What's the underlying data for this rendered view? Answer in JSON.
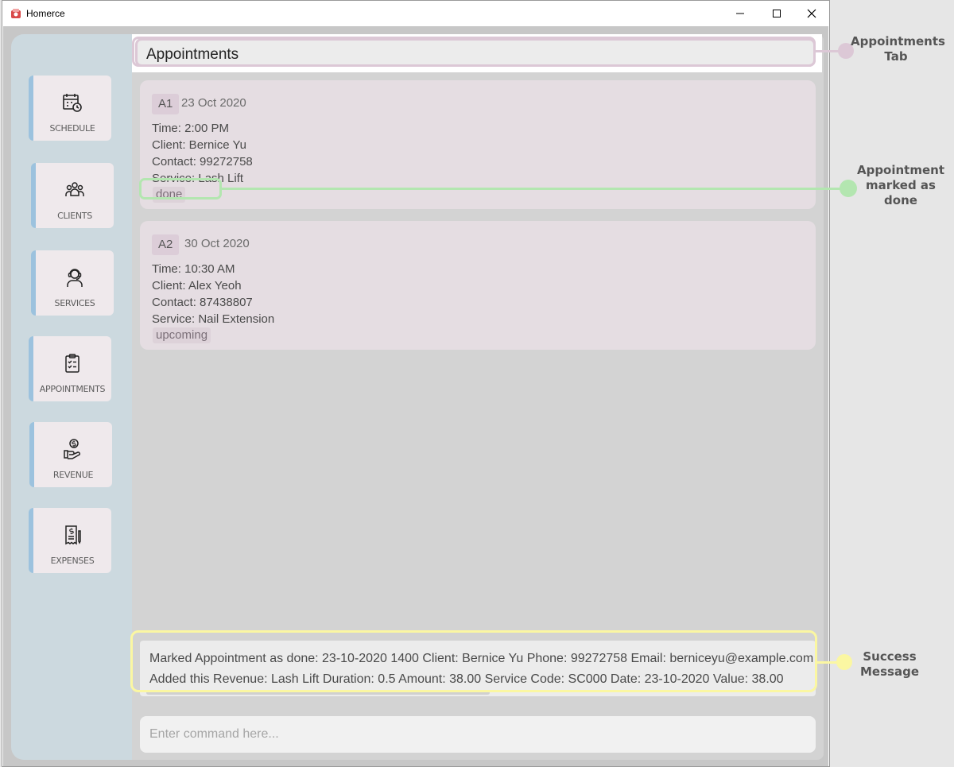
{
  "window": {
    "title": "Homerce",
    "controls": {
      "minimize": "minimize-icon",
      "maximize": "maximize-icon",
      "close": "close-icon"
    }
  },
  "sidebar": {
    "items": [
      {
        "label": "SCHEDULE",
        "icon": "calendar-clock-icon"
      },
      {
        "label": "CLIENTS",
        "icon": "people-group-icon"
      },
      {
        "label": "SERVICES",
        "icon": "headset-person-icon"
      },
      {
        "label": "APPOINTMENTS",
        "icon": "clipboard-checklist-icon"
      },
      {
        "label": "REVENUE",
        "icon": "hand-dollar-icon"
      },
      {
        "label": "EXPENSES",
        "icon": "receipt-dollar-icon"
      }
    ]
  },
  "tab": {
    "title": "Appointments"
  },
  "appointments": [
    {
      "id": "A1",
      "date": "23 Oct 2020",
      "time": "Time: 2:00 PM",
      "client": "Client: Bernice Yu",
      "contact": "Contact: 99272758",
      "service": "Service: Lash Lift",
      "status": "done"
    },
    {
      "id": "A2",
      "date": "30 Oct 2020",
      "time": "Time: 10:30 AM",
      "client": "Client: Alex Yeoh",
      "contact": "Contact: 87438807",
      "service": "Service: Nail Extension",
      "status": "upcoming"
    }
  ],
  "result": {
    "line1": "Marked Appointment as done: 23-10-2020 1400 Client: Bernice Yu Phone: 99272758 Email: berniceyu@example.com",
    "line2": "Added this Revenue: Lash Lift Duration: 0.5 Amount: 38.00 Service Code: SC000 Date: 23-10-2020 Value: 38.00"
  },
  "command": {
    "placeholder": "Enter command here..."
  },
  "callouts": {
    "appointments_tab": "Appointments Tab",
    "marked_done": "Appointment marked as done",
    "success": "Success Message"
  },
  "colors": {
    "tab_highlight": "#dcc8d6",
    "done_highlight": "#b3e6b0",
    "success_highlight": "#fbf7a2",
    "nav_accent": "#9cc2de"
  }
}
